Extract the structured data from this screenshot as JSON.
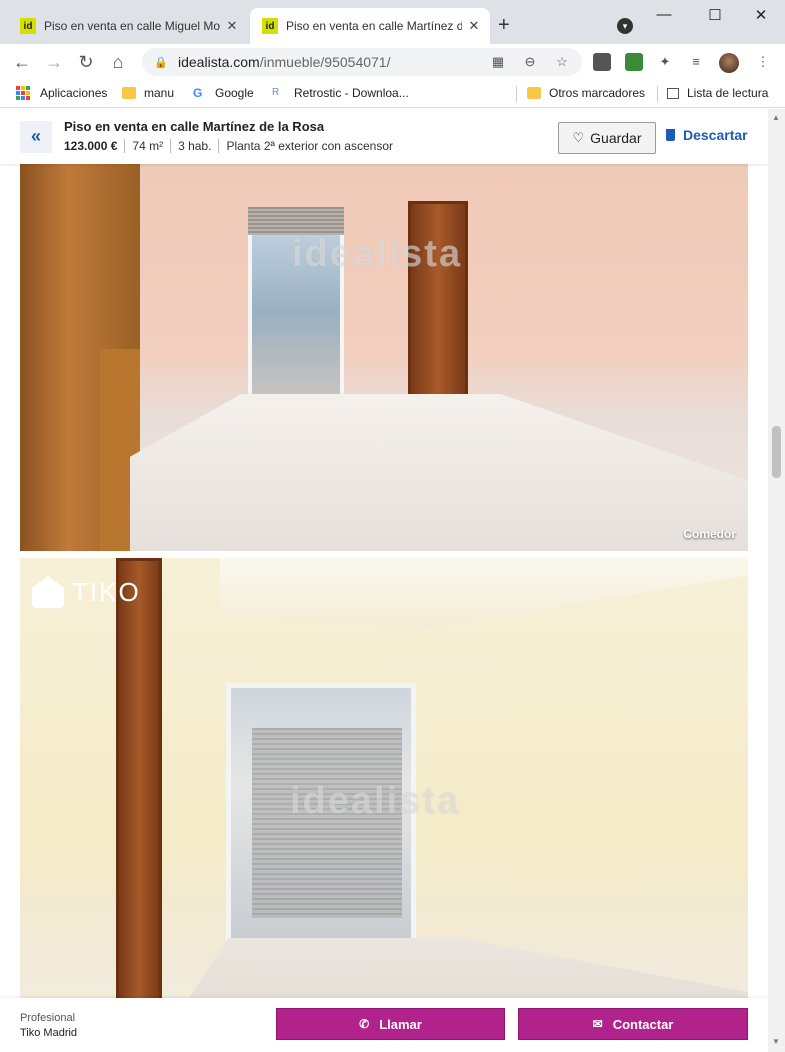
{
  "browser": {
    "tabs": [
      {
        "favicon": "id",
        "title": "Piso en venta en calle Miguel Mo",
        "close": "✕",
        "active": false
      },
      {
        "favicon": "id",
        "title": "Piso en venta en calle Martínez d",
        "close": "✕",
        "active": true
      }
    ],
    "new_tab": "+",
    "window_controls": {
      "minimize": "—",
      "maximize": "☐",
      "close": "✕"
    },
    "url_host": "idealista.com",
    "url_path": "/inmueble/95054071/",
    "bookmarks": [
      {
        "label": "Aplicaciones",
        "icon": "apps-icon"
      },
      {
        "label": "manu",
        "icon": "folder-icon"
      },
      {
        "label": "Google",
        "icon": "google-icon"
      },
      {
        "label": "Retrostic - Downloa...",
        "icon": "retrostic-icon"
      },
      {
        "label": "Otros marcadores",
        "icon": "folder-icon"
      },
      {
        "label": "Lista de lectura",
        "icon": "reading-list-icon"
      }
    ]
  },
  "listing": {
    "back": "«",
    "title": "Piso en venta en calle Martínez de la Rosa",
    "price": "123.000 €",
    "size": "74 m²",
    "rooms": "3 hab.",
    "floor": "Planta 2ª exterior con ascensor",
    "save_label": "Guardar",
    "discard_label": "Descartar"
  },
  "photos": [
    {
      "label": "Comedor",
      "watermark": "idealista"
    },
    {
      "label": "",
      "watermark": "idealista",
      "brand": "TIKO"
    }
  ],
  "contact": {
    "type": "Profesional",
    "agency": "Tiko Madrid",
    "call_label": "Llamar",
    "contact_label": "Contactar"
  },
  "colors": {
    "accent": "#b1228d",
    "link": "#1a5cb8",
    "idealista_green": "#d4e000"
  }
}
